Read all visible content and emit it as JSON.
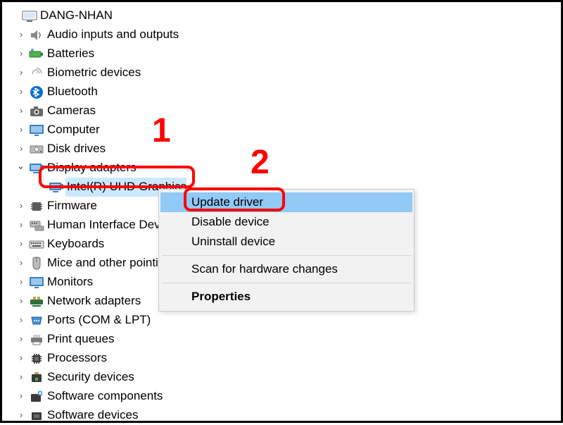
{
  "root": {
    "label": "DANG-NHAN"
  },
  "nodes": [
    {
      "label": "Audio inputs and outputs",
      "expanded": false
    },
    {
      "label": "Batteries",
      "expanded": false
    },
    {
      "label": "Biometric devices",
      "expanded": false
    },
    {
      "label": "Bluetooth",
      "expanded": false
    },
    {
      "label": "Cameras",
      "expanded": false
    },
    {
      "label": "Computer",
      "expanded": false
    },
    {
      "label": "Disk drives",
      "expanded": false
    },
    {
      "label": "Display adapters",
      "expanded": true,
      "children": [
        {
          "label": "Intel(R) UHD Graphics"
        }
      ]
    },
    {
      "label": "Firmware",
      "expanded": false
    },
    {
      "label": "Human Interface Devices",
      "expanded": false
    },
    {
      "label": "Keyboards",
      "expanded": false
    },
    {
      "label": "Mice and other pointing devices",
      "expanded": false
    },
    {
      "label": "Monitors",
      "expanded": false
    },
    {
      "label": "Network adapters",
      "expanded": false
    },
    {
      "label": "Ports (COM & LPT)",
      "expanded": false
    },
    {
      "label": "Print queues",
      "expanded": false
    },
    {
      "label": "Processors",
      "expanded": false
    },
    {
      "label": "Security devices",
      "expanded": false
    },
    {
      "label": "Software components",
      "expanded": false
    },
    {
      "label": "Software devices",
      "expanded": false
    }
  ],
  "context_menu": {
    "items": [
      {
        "key": "update",
        "label": "Update driver",
        "hovered": true
      },
      {
        "key": "disable",
        "label": "Disable device"
      },
      {
        "key": "uninstall",
        "label": "Uninstall device"
      },
      {
        "sep": true
      },
      {
        "key": "scan",
        "label": "Scan for hardware changes"
      },
      {
        "sep": true
      },
      {
        "key": "properties",
        "label": "Properties",
        "bold": true
      }
    ]
  },
  "annotations": {
    "marker1": "1",
    "marker2": "2"
  },
  "colors": {
    "highlight_bg": "#91c9f7",
    "annotation_red": "#ff0000"
  }
}
